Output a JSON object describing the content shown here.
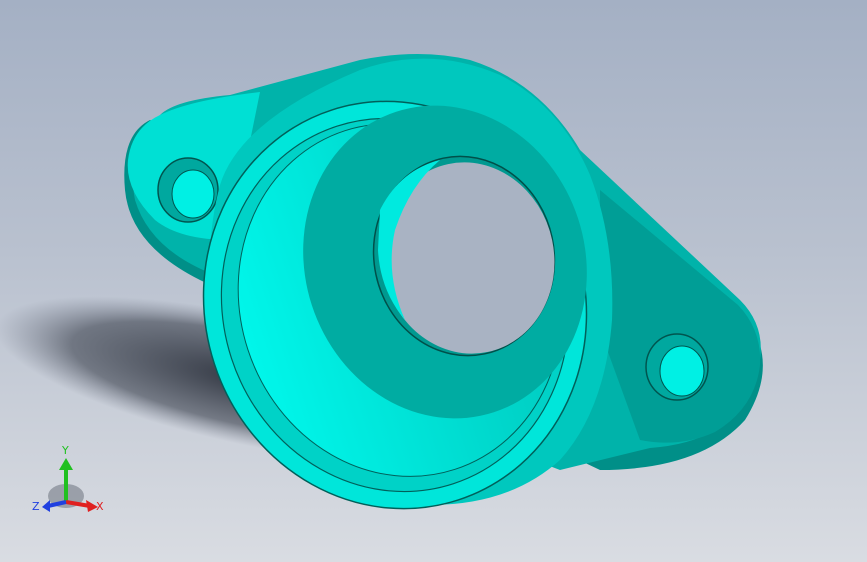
{
  "viewport": {
    "background_top": "#a4b0c4",
    "background_bottom": "#d9dce2",
    "part_color": "#00ffee",
    "part_shadow_color": "#008f88"
  },
  "triad": {
    "x_label": "X",
    "y_label": "Y",
    "z_label": "Z",
    "x_color": "#e02020",
    "y_color": "#20c020",
    "z_color": "#2040e0"
  }
}
